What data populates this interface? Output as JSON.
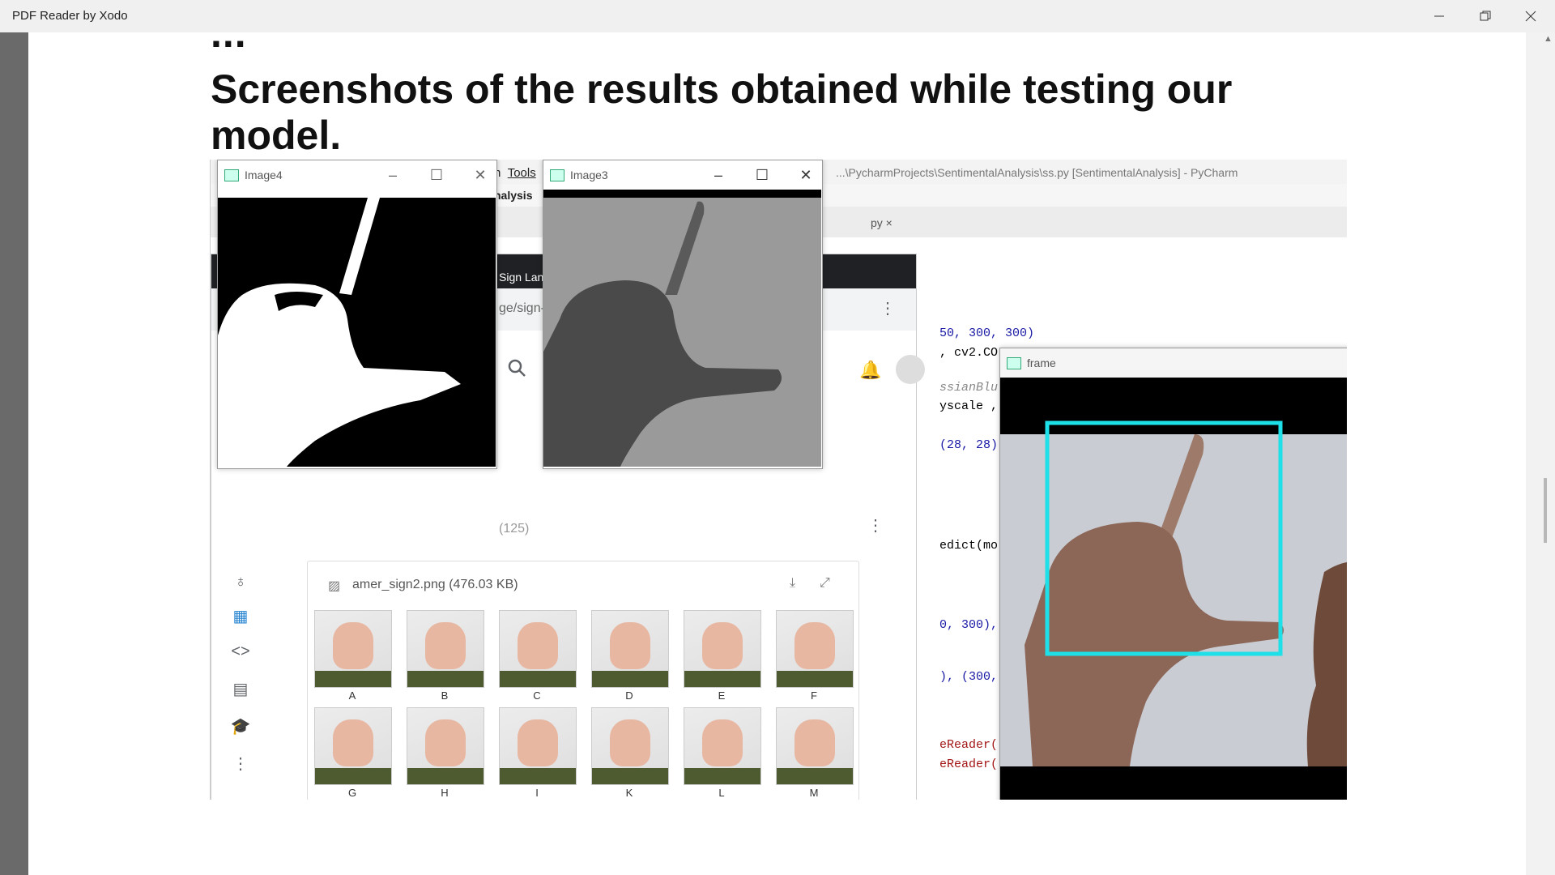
{
  "window": {
    "title": "PDF Reader by Xodo",
    "minimize_icon": "minimize-icon",
    "restore_icon": "restore-icon",
    "close_icon": "close-icon"
  },
  "document": {
    "heading": "Screenshots of the results obtained while testing our model."
  },
  "screenshot": {
    "pycharm": {
      "title": "...\\PycharmProjects\\SentimentalAnalysis\\ss.py [SentimentalAnalysis] - PyCharm",
      "menu_tools": "Tools",
      "menu_n": "n",
      "breadcrumb": "nalysis",
      "tab": "py",
      "code_lines": [
        "50, 300, 300)",
        ", cv2.CO",
        "ssianBlu",
        "yscale ,",
        "(28, 28)",
        "edict(mo",
        "0, 300),",
        "), (300,",
        "eReader(",
        "eReader("
      ]
    },
    "browser": {
      "tab_label": "Sign Lang",
      "address": "ge/sign-",
      "count": "(125)",
      "file_name": "amer_sign2.png (476.03 KB)",
      "letters": [
        "A",
        "B",
        "C",
        "D",
        "E",
        "F",
        "G",
        "H",
        "I",
        "K",
        "L",
        "M"
      ]
    },
    "image4": {
      "title": "Image4"
    },
    "image3": {
      "title": "Image3"
    },
    "frame": {
      "title": "frame",
      "box_color": "#1ee0e8"
    }
  }
}
